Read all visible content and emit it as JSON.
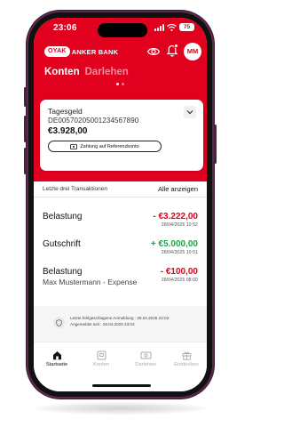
{
  "status_bar": {
    "time": "23:06",
    "battery": "75"
  },
  "header": {
    "logo_mark": "OYAK",
    "logo_text": "ANKER BANK",
    "avatar_initials": "MM"
  },
  "tabs": [
    {
      "label": "Konten",
      "active": true
    },
    {
      "label": "Darlehen",
      "active": false
    }
  ],
  "account_card": {
    "name": "Tagesgeld",
    "iban": "DE00570205001234567890",
    "balance": "€3.928,00",
    "transfer_button": "Zahlung auf Referenzkonto"
  },
  "transactions": {
    "header_title": "Letzte drei Transaktionen",
    "show_all": "Alle anzeigen",
    "items": [
      {
        "title": "Belastung",
        "subtitle": "",
        "amount": "- €3.222,00",
        "date": "28/04/2025 10:52",
        "sign": "negative"
      },
      {
        "title": "Gutschrift",
        "subtitle": "",
        "amount": "+ €5.000,00",
        "date": "28/04/2025 10:51",
        "sign": "positive"
      },
      {
        "title": "Belastung",
        "subtitle": "Max Mustermann - Expense",
        "amount": "- €100,00",
        "date": "28/04/2025 08:00",
        "sign": "negative"
      }
    ]
  },
  "login_info": {
    "failed_label": "Letzte fehlgeschlagene Anmeldung :",
    "failed_value": "29.04.2025 23:03",
    "logged_in_label": "Angemeldet seit :",
    "logged_in_value": "29.04.2025 23:03"
  },
  "bottom_nav": [
    {
      "label": "Startseite",
      "icon": "home-icon",
      "active": true
    },
    {
      "label": "Konten",
      "icon": "accounts-icon",
      "active": false
    },
    {
      "label": "Darlehen",
      "icon": "loans-icon",
      "active": false
    },
    {
      "label": "Entdecken",
      "icon": "gift-icon",
      "active": false
    }
  ],
  "colors": {
    "brand_red": "#e1001e",
    "positive_green": "#1ea34a",
    "phone_frame": "#5b2a4a"
  }
}
